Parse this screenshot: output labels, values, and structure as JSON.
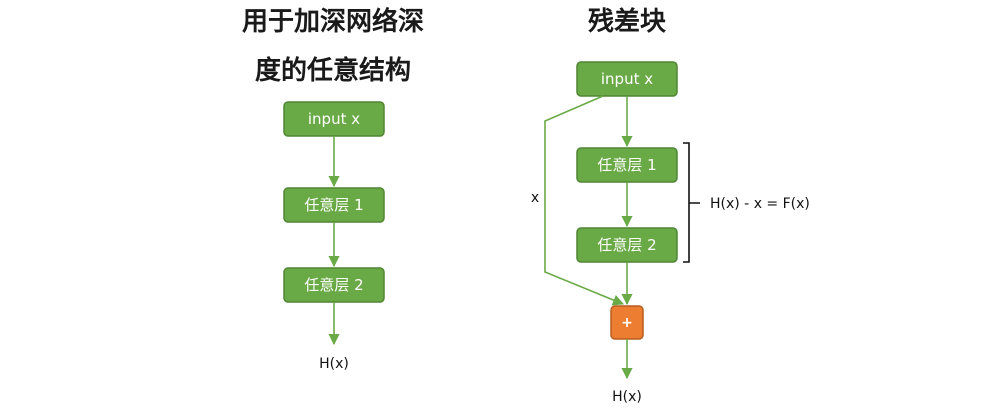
{
  "left": {
    "title_line1": "用于加深网络深",
    "title_line2": "度的任意结构",
    "input_label": "input x",
    "layer1_label": "任意层 1",
    "layer2_label": "任意层 2",
    "output_label": "H(x)"
  },
  "right": {
    "title": "残差块",
    "input_label": "input x",
    "layer1_label": "任意层 1",
    "layer2_label": "任意层 2",
    "skip_label": "x",
    "residual_label": "H(x) - x = F(x)",
    "add_label": "+",
    "output_label": "H(x)"
  },
  "colors": {
    "node_fill": "#6aaa46",
    "add_fill": "#ed7d31",
    "edge": "#6aaa46"
  }
}
